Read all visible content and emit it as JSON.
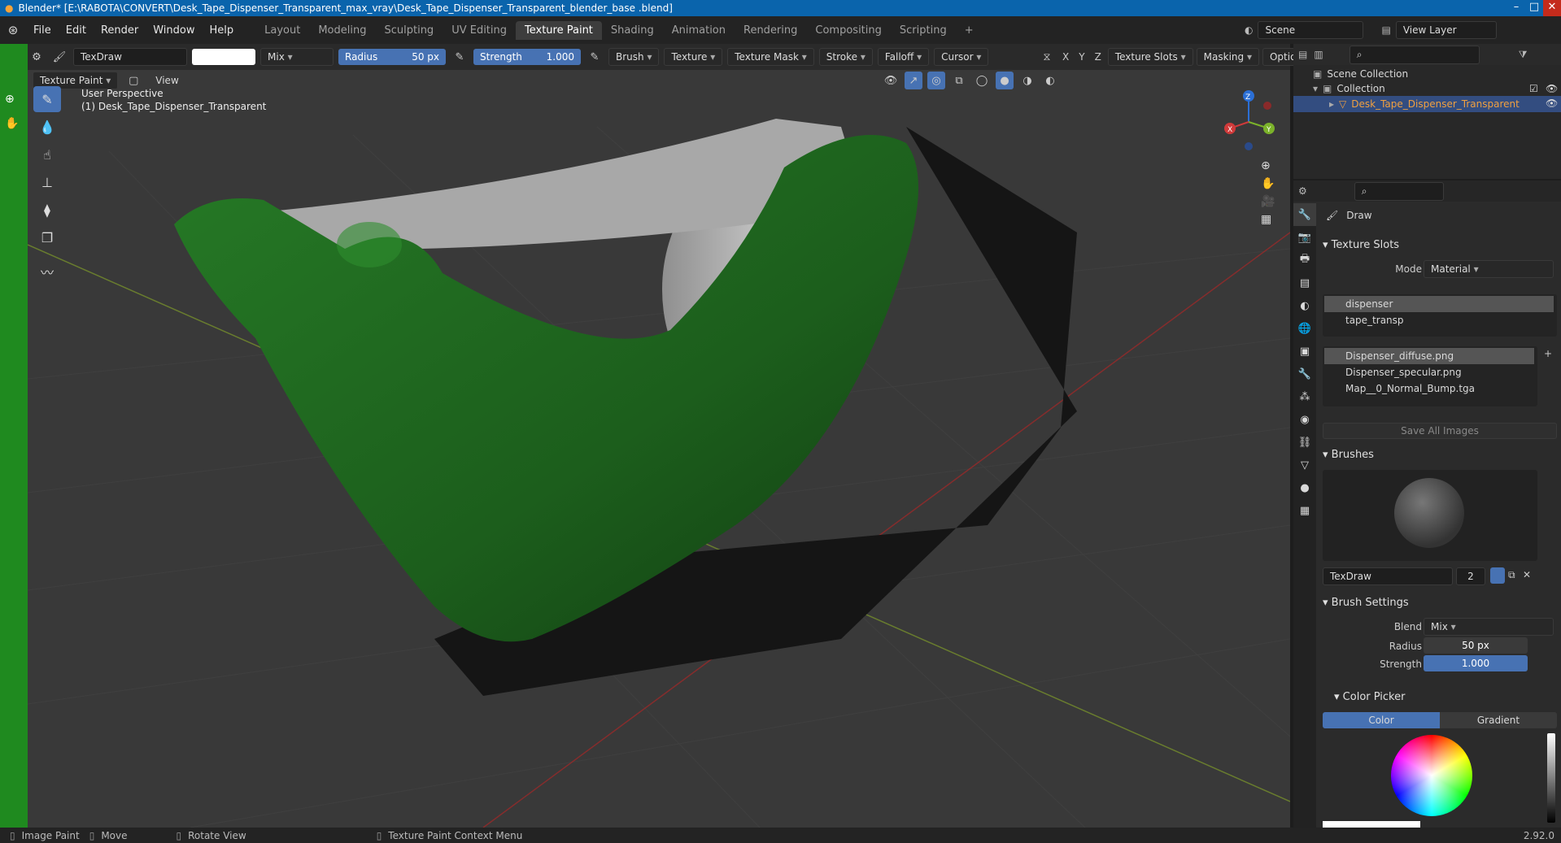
{
  "window": {
    "title": "Blender* [E:\\RABOTA\\CONVERT\\Desk_Tape_Dispenser_Transparent_max_vray\\Desk_Tape_Dispenser_Transparent_blender_base .blend]"
  },
  "menu": [
    "File",
    "Edit",
    "Render",
    "Window",
    "Help"
  ],
  "workspaces": [
    {
      "label": "Layout",
      "active": false
    },
    {
      "label": "Modeling",
      "active": false
    },
    {
      "label": "Sculpting",
      "active": false
    },
    {
      "label": "UV Editing",
      "active": false
    },
    {
      "label": "Texture Paint",
      "active": true
    },
    {
      "label": "Shading",
      "active": false
    },
    {
      "label": "Animation",
      "active": false
    },
    {
      "label": "Rendering",
      "active": false
    },
    {
      "label": "Compositing",
      "active": false
    },
    {
      "label": "Scripting",
      "active": false
    }
  ],
  "scene": {
    "label": "Scene",
    "view_layer": "View Layer"
  },
  "toolheader": {
    "brush_name": "TexDraw",
    "blend": "Mix",
    "radius_label": "Radius",
    "radius_value": "50 px",
    "strength_label": "Strength",
    "strength_value": "1.000",
    "menus": [
      "Brush",
      "Texture",
      "Texture Mask",
      "Stroke",
      "Falloff",
      "Cursor"
    ],
    "axes": [
      "X",
      "Y",
      "Z"
    ],
    "right_menus": [
      "Texture Slots",
      "Masking",
      "Options"
    ]
  },
  "viewport": {
    "mode": "Texture Paint",
    "view_menu": "View",
    "perspective": "User Perspective",
    "object": "(1) Desk_Tape_Dispenser_Transparent",
    "gizmo": {
      "x": "X",
      "y": "Y",
      "z": "Z"
    }
  },
  "outliner": {
    "scene_collection": "Scene Collection",
    "collection": "Collection",
    "object": "Desk_Tape_Dispenser_Transparent"
  },
  "properties": {
    "tool_name": "Draw",
    "texture_slots": {
      "header": "Texture Slots",
      "mode_label": "Mode",
      "mode_value": "Material",
      "materials": [
        "dispenser",
        "tape_transp"
      ],
      "images": [
        "Dispenser_diffuse.png",
        "Dispenser_specular.png",
        "Map__0_Normal_Bump.tga"
      ],
      "save_all": "Save All Images"
    },
    "brushes": {
      "header": "Brushes",
      "name": "TexDraw",
      "users": "2"
    },
    "brush_settings": {
      "header": "Brush Settings",
      "blend_label": "Blend",
      "blend_value": "Mix",
      "radius_label": "Radius",
      "radius_value": "50 px",
      "strength_label": "Strength",
      "strength_value": "1.000"
    },
    "color_picker": {
      "header": "Color Picker",
      "tab_color": "Color",
      "tab_gradient": "Gradient"
    }
  },
  "statusbar": {
    "left": "Image Paint",
    "move": "Move",
    "rotate": "Rotate View",
    "context": "Texture Paint Context Menu",
    "version": "2.92.0"
  },
  "colors": {
    "accent": "#4772b3",
    "dispenser": "#1e6a1e",
    "tape": "#b4b4b4"
  }
}
